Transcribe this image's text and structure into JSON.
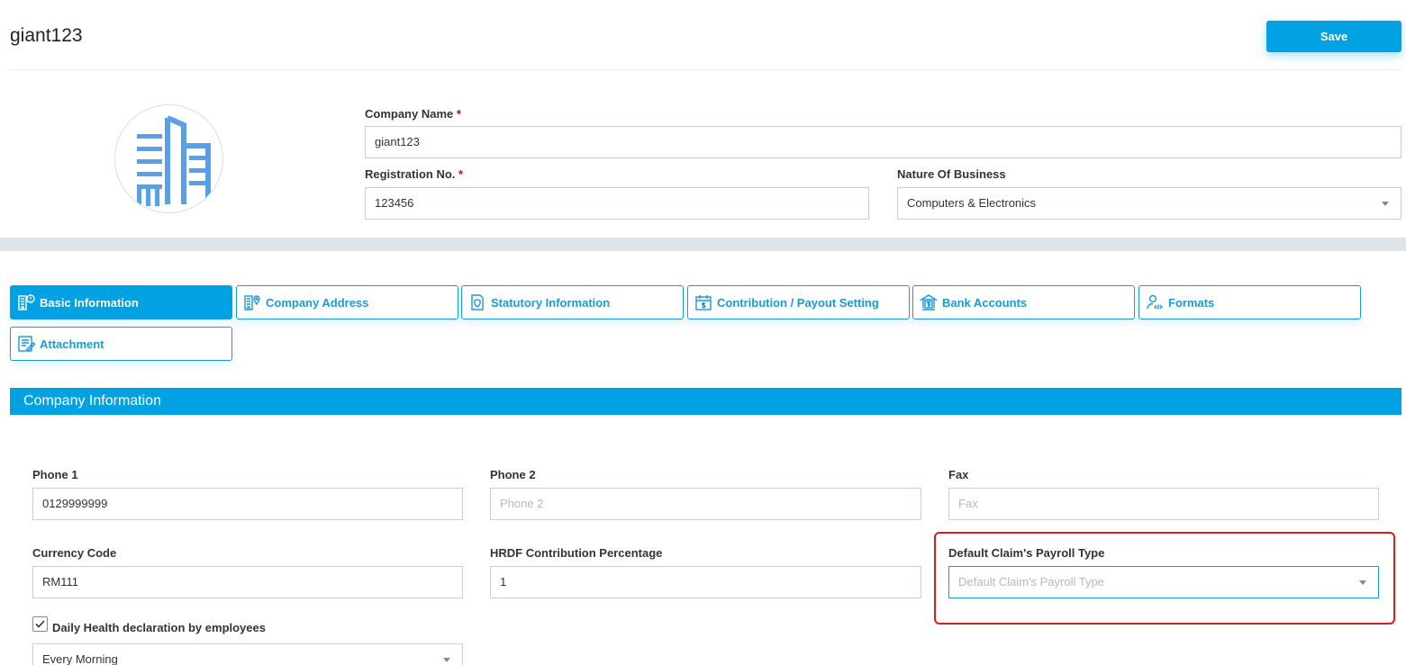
{
  "header": {
    "title": "giant123",
    "save_label": "Save"
  },
  "company": {
    "name_label": "Company Name",
    "name_value": "giant123",
    "reg_label": "Registration No.",
    "reg_value": "123456",
    "nature_label": "Nature Of Business",
    "nature_value": "Computers & Electronics",
    "required_mark": "*"
  },
  "tabs": [
    {
      "label": "Basic Information",
      "icon": "building-info-icon",
      "active": true
    },
    {
      "label": "Company Address",
      "icon": "building-location-icon",
      "active": false
    },
    {
      "label": "Statutory Information",
      "icon": "document-shield-icon",
      "active": false
    },
    {
      "label": "Contribution / Payout Setting",
      "icon": "calendar-dollar-icon",
      "active": false
    },
    {
      "label": "Bank Accounts",
      "icon": "bank-dollar-icon",
      "active": false
    },
    {
      "label": "Formats",
      "icon": "user-code-icon",
      "active": false
    },
    {
      "label": "Attachment",
      "icon": "document-edit-icon",
      "active": false
    }
  ],
  "section": {
    "title": "Company Information"
  },
  "fields": {
    "phone1": {
      "label": "Phone 1",
      "value": "0129999999"
    },
    "phone2": {
      "label": "Phone 2",
      "placeholder": "Phone 2"
    },
    "fax": {
      "label": "Fax",
      "placeholder": "Fax"
    },
    "currency": {
      "label": "Currency Code",
      "value": "RM111"
    },
    "hrdf": {
      "label": "HRDF Contribution Percentage",
      "value": "1"
    },
    "claim_type": {
      "label": "Default Claim's Payroll Type",
      "placeholder": "Default Claim's Payroll Type"
    },
    "health": {
      "label": "Daily Health declaration by employees",
      "checked": true,
      "value": "Every Morning"
    }
  },
  "colors": {
    "accent": "#00a2e3",
    "highlight": "#e0191c",
    "required": "#d0021b"
  }
}
